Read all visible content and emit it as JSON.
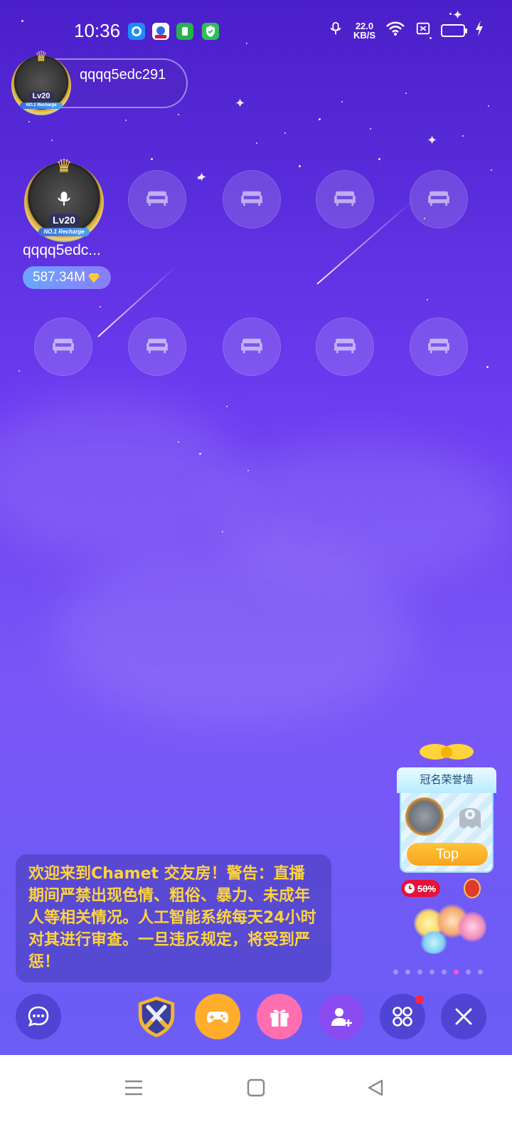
{
  "status_bar": {
    "time": "10:36",
    "net_speed_value": "22.0",
    "net_speed_unit": "KB/S",
    "battery_color": "#ffd54a",
    "icons": [
      "app-icon-blue",
      "app-icon-baidu",
      "app-icon-green",
      "shield-icon",
      "mic-icon",
      "wifi-icon",
      "sim-off-icon",
      "battery-icon",
      "charging-icon"
    ]
  },
  "host_chip": {
    "name": "qqqq5edc291",
    "level": "Lv20",
    "recharge_badge": "NO.1 Recharge"
  },
  "host_seat": {
    "name": "qqqq5edc...",
    "level": "Lv20",
    "recharge_badge": "NO.1 Recharge",
    "coins": "587.34M",
    "coin_icon": "diamond-icon"
  },
  "empty_seats": {
    "icon": "sofa-icon",
    "count": 9
  },
  "honor_wall": {
    "title": "冠名荣誉墙",
    "button": "Top"
  },
  "notice": {
    "text": "欢迎来到Chamet 交友房！警告：直播期间严禁出现色情、粗俗、暴力、未成年人等相关情况。人工智能系统每天24小时对其进行审查。一旦违反规定，将受到严惩！"
  },
  "promo": {
    "badge": "50%",
    "page_count": 8,
    "active_page": 6
  },
  "toolbar": {
    "buttons": [
      "chat-icon",
      "pk-battle-icon",
      "game-icon",
      "gift-icon",
      "add-user-icon",
      "more-apps-icon",
      "close-icon"
    ],
    "more_has_notification": true
  },
  "colors": {
    "background_top": "#4a1fc9",
    "background_bottom": "#6a5ef4",
    "notice_text": "#ffd43b",
    "accent_pink": "#ff4fd8"
  }
}
